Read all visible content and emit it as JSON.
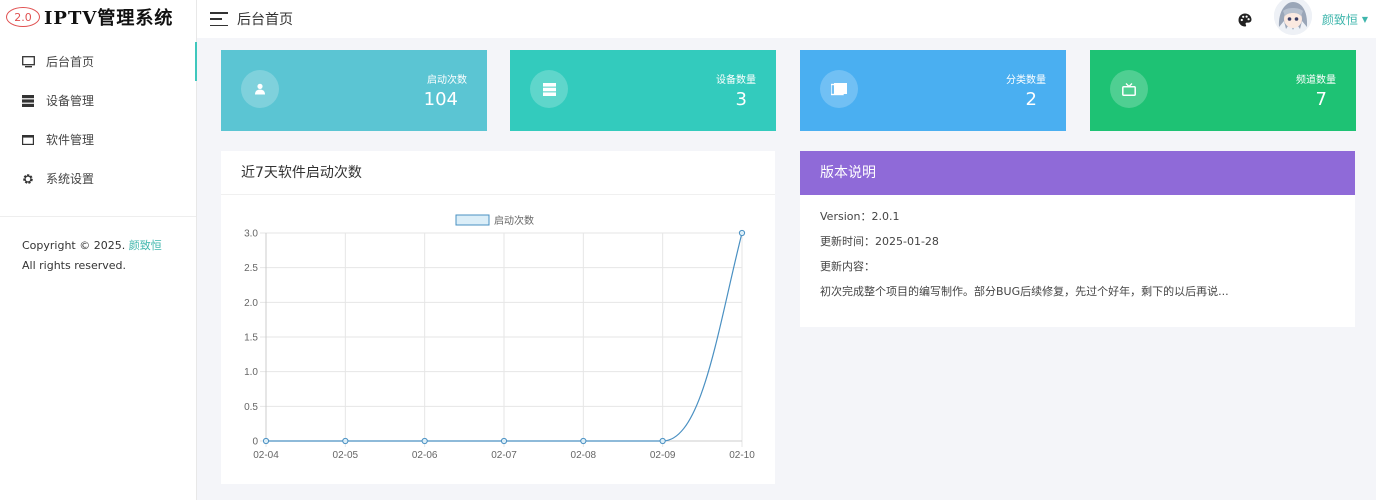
{
  "app": {
    "logo_badge": "2.0",
    "logo_text": "IPTV管理系统"
  },
  "sidebar": {
    "items": [
      {
        "label": "后台首页",
        "icon": "monitor-icon"
      },
      {
        "label": "设备管理",
        "icon": "server-icon"
      },
      {
        "label": "软件管理",
        "icon": "window-icon"
      },
      {
        "label": "系统设置",
        "icon": "gear-icon"
      }
    ],
    "active_index": 0,
    "copyright_prefix": "Copyright © 2025.",
    "copyright_author": "颜致恒",
    "copyright_suffix": "All rights reserved."
  },
  "header": {
    "title": "后台首页",
    "username": "颜致恒"
  },
  "stats": [
    {
      "label": "启动次数",
      "value": "104",
      "color": "#5bc5d3",
      "icon": "user-icon"
    },
    {
      "label": "设备数量",
      "value": "3",
      "color": "#33cbbd",
      "icon": "server-icon"
    },
    {
      "label": "分类数量",
      "value": "2",
      "color": "#4aaff1",
      "icon": "folder-icon"
    },
    {
      "label": "频道数量",
      "value": "7",
      "color": "#1ec274",
      "icon": "tv-icon"
    }
  ],
  "chart_panel": {
    "title": "近7天软件启动次数"
  },
  "chart_data": {
    "type": "line",
    "categories": [
      "02-04",
      "02-05",
      "02-06",
      "02-07",
      "02-08",
      "02-09",
      "02-10"
    ],
    "series": [
      {
        "name": "启动次数",
        "values": [
          0,
          0,
          0,
          0,
          0,
          0,
          3
        ]
      }
    ],
    "ylim": [
      0,
      3.0
    ],
    "yticks": [
      "0",
      "0.5",
      "1.0",
      "1.5",
      "2.0",
      "2.5",
      "3.0"
    ],
    "legend": "top-center",
    "grid": true,
    "line_color": "#4a90c2",
    "fill_color": "#dbeef8"
  },
  "version_panel": {
    "title": "版本说明",
    "version": "Version：2.0.1",
    "updated": "更新时间：2025-01-28",
    "content_label": "更新内容：",
    "content": "初次完成整个项目的编写制作。部分BUG后续修复，先过个好年，剩下的以后再说..."
  }
}
